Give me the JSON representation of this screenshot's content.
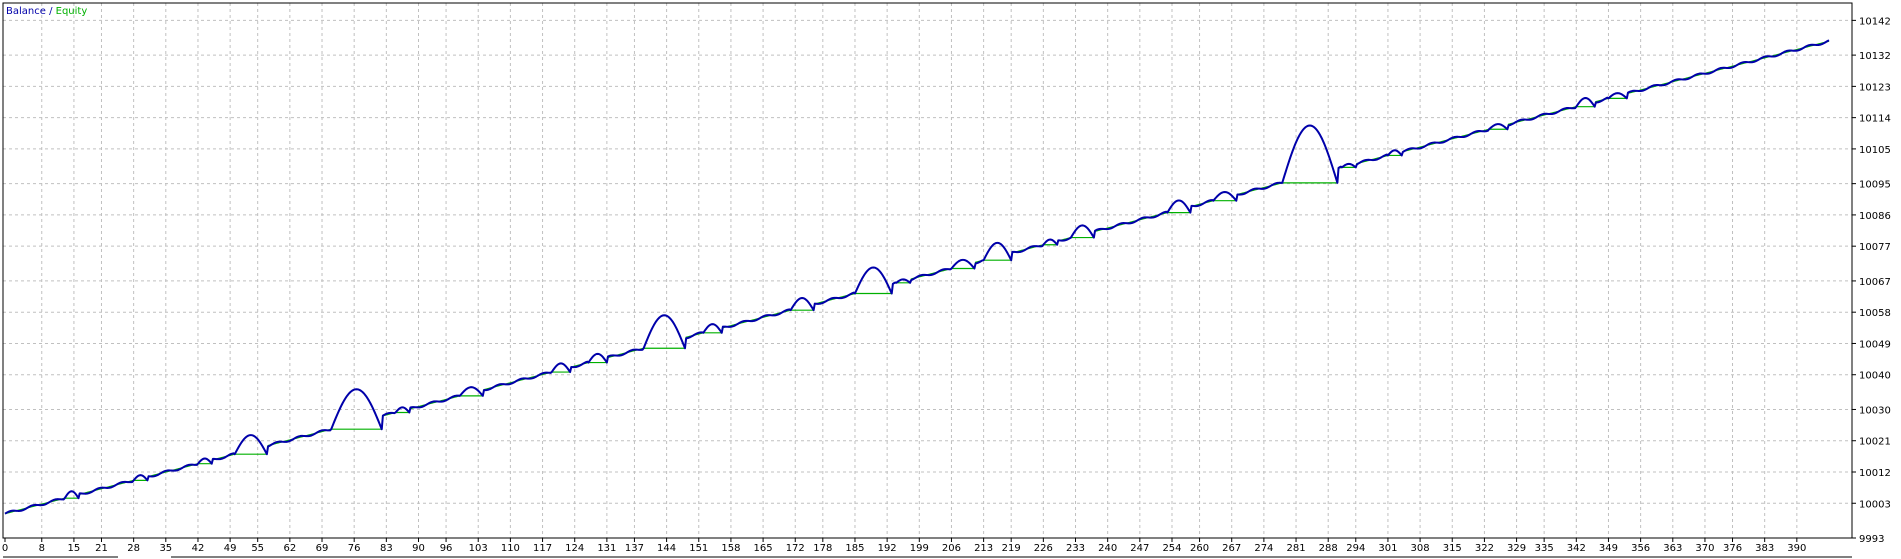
{
  "chart_data": {
    "type": "line",
    "legend": {
      "placement": "top-left",
      "items": [
        {
          "label": "Balance",
          "color": "#0000aa"
        },
        {
          "label": "Equity",
          "color": "#00b000"
        }
      ],
      "separator": " / "
    },
    "grid": true,
    "colors": {
      "balance": "#0000aa",
      "equity": "#00b000",
      "grid": "#c0c0c0",
      "frame": "#000000",
      "background": "#ffffff"
    },
    "xlim": [
      0,
      397
    ],
    "ylim": [
      9993,
      10147
    ],
    "x_ticks": [
      0,
      8,
      15,
      21,
      28,
      35,
      42,
      49,
      55,
      62,
      69,
      76,
      83,
      90,
      96,
      103,
      110,
      117,
      124,
      131,
      137,
      144,
      151,
      158,
      165,
      172,
      178,
      185,
      192,
      199,
      206,
      213,
      219,
      226,
      233,
      240,
      247,
      254,
      260,
      267,
      274,
      281,
      288,
      294,
      301,
      308,
      315,
      322,
      329,
      335,
      342,
      349,
      356,
      363,
      370,
      376,
      383,
      390
    ],
    "y_ticks": [
      9993,
      10003,
      10012,
      10021,
      10030,
      10040,
      10049,
      10058,
      10067,
      10077,
      10086,
      10095,
      10105,
      10114,
      10123,
      10132,
      10142
    ],
    "balance": {
      "name": "Balance",
      "x": [
        0,
        397
      ],
      "y": [
        10000,
        10136
      ]
    },
    "equity_bumps": [
      {
        "start": 13,
        "end": 16,
        "peak": 2.0
      },
      {
        "start": 28,
        "end": 31,
        "peak": 1.5
      },
      {
        "start": 42,
        "end": 45,
        "peak": 1.5
      },
      {
        "start": 50,
        "end": 57,
        "peak": 5.5
      },
      {
        "start": 71,
        "end": 82,
        "peak": 11.5
      },
      {
        "start": 85,
        "end": 88,
        "peak": 1.5
      },
      {
        "start": 99,
        "end": 104,
        "peak": 2.5
      },
      {
        "start": 119,
        "end": 123,
        "peak": 2.5
      },
      {
        "start": 127,
        "end": 131,
        "peak": 2.5
      },
      {
        "start": 139,
        "end": 148,
        "peak": 9.5
      },
      {
        "start": 152,
        "end": 156,
        "peak": 2.5
      },
      {
        "start": 171,
        "end": 176,
        "peak": 3.5
      },
      {
        "start": 185,
        "end": 193,
        "peak": 7.5
      },
      {
        "start": 194,
        "end": 197,
        "peak": 1.0
      },
      {
        "start": 206,
        "end": 211,
        "peak": 2.5
      },
      {
        "start": 213,
        "end": 219,
        "peak": 5.0
      },
      {
        "start": 226,
        "end": 229,
        "peak": 1.5
      },
      {
        "start": 232,
        "end": 237,
        "peak": 3.5
      },
      {
        "start": 253,
        "end": 258,
        "peak": 3.5
      },
      {
        "start": 263,
        "end": 268,
        "peak": 2.5
      },
      {
        "start": 278,
        "end": 290,
        "peak": 16.5
      },
      {
        "start": 291,
        "end": 294,
        "peak": 1.0
      },
      {
        "start": 301,
        "end": 304,
        "peak": 1.5
      },
      {
        "start": 323,
        "end": 327,
        "peak": 1.5
      },
      {
        "start": 342,
        "end": 346,
        "peak": 2.5
      },
      {
        "start": 349,
        "end": 353,
        "peak": 1.5
      }
    ]
  }
}
